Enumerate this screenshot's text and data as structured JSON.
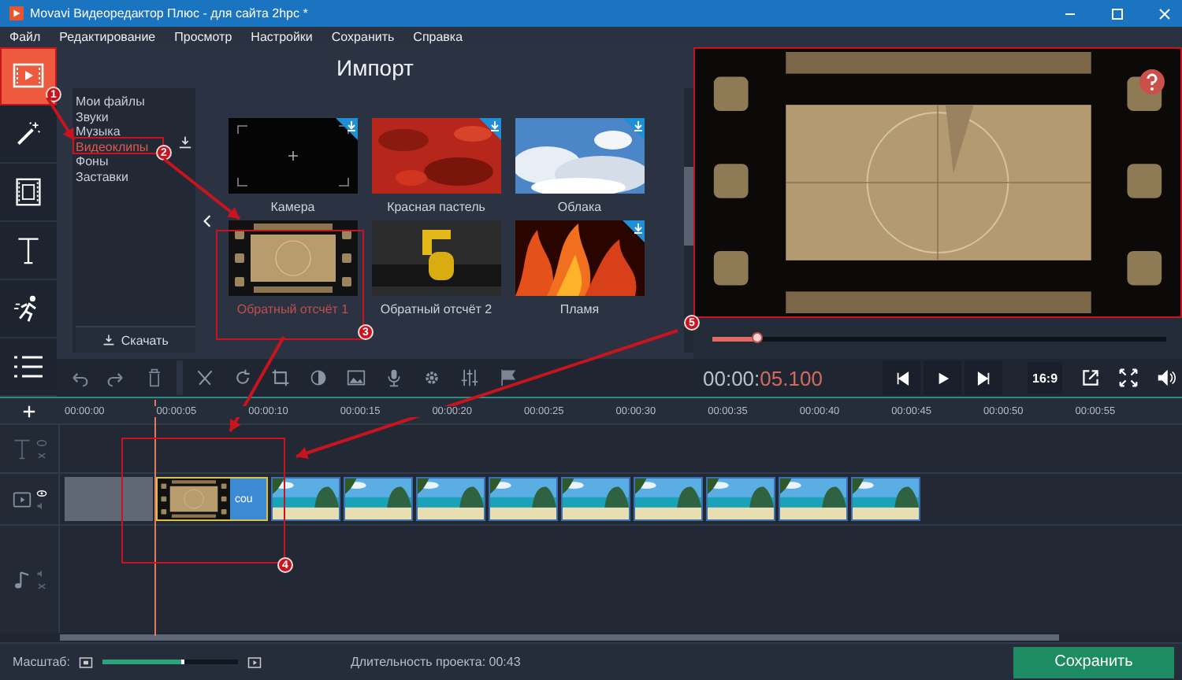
{
  "window": {
    "title": "Movavi Видеоредактор Плюс - для сайта 2hpc *"
  },
  "menu": [
    "Файл",
    "Редактирование",
    "Просмотр",
    "Настройки",
    "Сохранить",
    "Справка"
  ],
  "tools": [
    {
      "kind": "import",
      "selected": true
    },
    {
      "kind": "filters",
      "selected": false
    },
    {
      "kind": "transitions",
      "selected": false
    },
    {
      "kind": "titles",
      "selected": false
    },
    {
      "kind": "motion",
      "selected": false
    },
    {
      "kind": "more",
      "selected": false
    }
  ],
  "import": {
    "title": "Импорт",
    "categories": [
      {
        "label": "Мои файлы",
        "selected": false
      },
      {
        "label": "Звуки",
        "selected": false
      },
      {
        "label": "Музыка",
        "selected": false
      },
      {
        "label": "Видеоклипы",
        "selected": true
      },
      {
        "label": "Фоны",
        "selected": false
      },
      {
        "label": "Заставки",
        "selected": false
      }
    ],
    "download_button": "Скачать",
    "clips": [
      {
        "label": "Камера",
        "downloadable": true,
        "selected": false
      },
      {
        "label": "Красная пастель",
        "downloadable": true,
        "selected": false
      },
      {
        "label": "Облака",
        "downloadable": true,
        "selected": false
      },
      {
        "label": "Обратный отсчёт 1",
        "downloadable": false,
        "selected": true
      },
      {
        "label": "Обратный отсчёт 2",
        "downloadable": false,
        "selected": false
      },
      {
        "label": "Пламя",
        "downloadable": true,
        "selected": false
      }
    ]
  },
  "preview": {
    "position": {
      "level": 0.1
    },
    "time": "00:00:",
    "time_accent": "05.100",
    "aspect": "16:9"
  },
  "timeline": {
    "ticks": [
      "00:00:00",
      "00:00:05",
      "00:00:10",
      "00:00:15",
      "00:00:20",
      "00:00:25",
      "00:00:30",
      "00:00:35",
      "00:00:40",
      "00:00:45",
      "00:00:50",
      "00:00:55"
    ],
    "title_clip": "cou"
  },
  "status_bar": {
    "zoom_label": "Масштаб:",
    "zoom": {
      "level": 0.6
    },
    "duration": "Длительность проекта: 00:43",
    "save_button": "Сохранить"
  },
  "annotations": [
    {
      "label": "1"
    },
    {
      "label": "2"
    },
    {
      "label": "3"
    },
    {
      "label": "4"
    },
    {
      "label": "5"
    }
  ]
}
